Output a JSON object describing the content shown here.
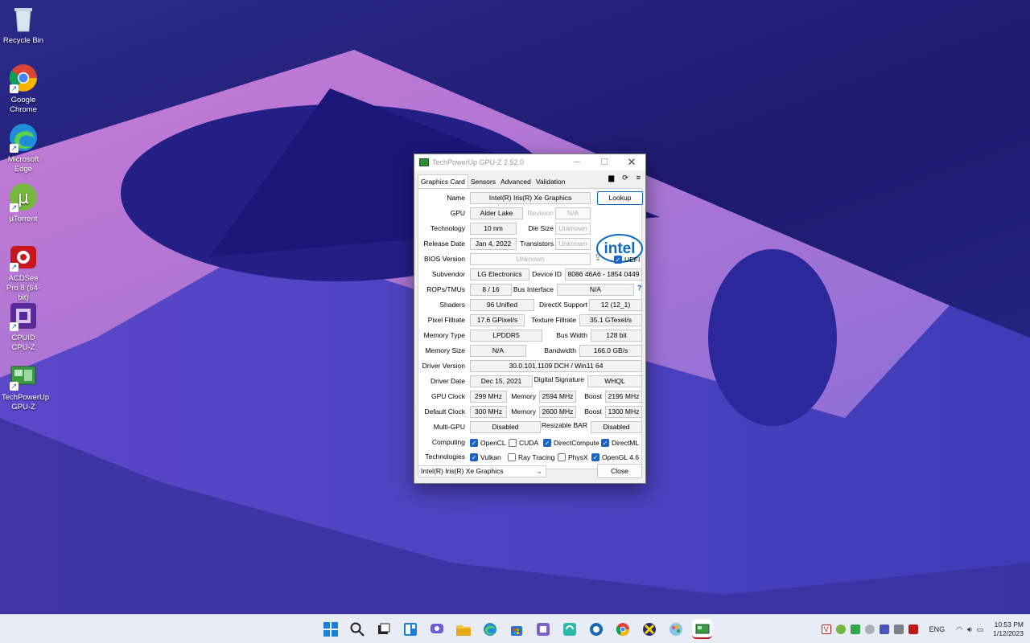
{
  "desktop": {
    "icons": [
      {
        "label": "Recycle Bin"
      },
      {
        "label": "Google Chrome"
      },
      {
        "label": "Microsoft Edge"
      },
      {
        "label": "µTorrent"
      },
      {
        "label": "ACDSee Pro 8 (64-bit)"
      },
      {
        "label": "CPUID CPU-Z"
      },
      {
        "label": "TechPowerUp GPU-Z"
      }
    ]
  },
  "window": {
    "title": "TechPowerUp GPU-Z 2.52.0",
    "tabs": [
      "Graphics Card",
      "Sensors",
      "Advanced",
      "Validation"
    ],
    "lookup_label": "Lookup",
    "logo_text": "intel",
    "fields": {
      "name_label": "Name",
      "name": "Intel(R) Iris(R) Xe Graphics",
      "gpu_label": "GPU",
      "gpu": "Alder Lake",
      "revision_label": "Revision",
      "revision": "N/A",
      "technology_label": "Technology",
      "technology": "10 nm",
      "die_size_label": "Die Size",
      "die_size": "Unknown",
      "release_date_label": "Release Date",
      "release_date": "Jan 4, 2022",
      "transistors_label": "Transistors",
      "transistors": "Unknown",
      "bios_label": "BIOS Version",
      "bios": "Unknown",
      "uefi_label": "UEFI",
      "subvendor_label": "Subvendor",
      "subvendor": "LG Electronics",
      "device_id_label": "Device ID",
      "device_id": "8086 46A6 - 1854 0449",
      "rops_label": "ROPs/TMUs",
      "rops": "8 / 16",
      "bus_interface_label": "Bus Interface",
      "bus_interface": "N/A",
      "help": "?",
      "shaders_label": "Shaders",
      "shaders": "96 Unified",
      "directx_label": "DirectX Support",
      "directx": "12 (12_1)",
      "pixel_label": "Pixel Fillrate",
      "pixel": "17.6 GPixel/s",
      "texture_label": "Texture Fillrate",
      "texture": "35.1 GTexel/s",
      "memtype_label": "Memory Type",
      "memtype": "LPDDR5",
      "buswidth_label": "Bus Width",
      "buswidth": "128 bit",
      "memsize_label": "Memory Size",
      "memsize": "N/A",
      "bandwidth_label": "Bandwidth",
      "bandwidth": "166.0 GB/s",
      "driver_version_label": "Driver Version",
      "driver_version": "30.0.101.1109 DCH / Win11 64",
      "driver_date_label": "Driver Date",
      "driver_date": "Dec 15, 2021",
      "digsig_label": "Digital Signature",
      "digsig": "WHQL",
      "gpuclock_label": "GPU Clock",
      "gpuclock": "299 MHz",
      "memory_label": "Memory",
      "gpu_memory": "2594 MHz",
      "boost_label": "Boost",
      "gpu_boost": "2195 MHz",
      "defclock_label": "Default Clock",
      "defclock": "300 MHz",
      "def_memory": "2600 MHz",
      "def_boost": "1300 MHz",
      "multigpu_label": "Multi-GPU",
      "multigpu": "Disabled",
      "rebar_label": "Resizable BAR",
      "rebar": "Disabled",
      "computing_label": "Computing",
      "technologies_label": "Technologies"
    },
    "computing": [
      {
        "label": "OpenCL",
        "checked": true
      },
      {
        "label": "CUDA",
        "checked": false
      },
      {
        "label": "DirectCompute",
        "checked": true
      },
      {
        "label": "DirectML",
        "checked": true
      }
    ],
    "technologies": [
      {
        "label": "Vulkan",
        "checked": true
      },
      {
        "label": "Ray Tracing",
        "checked": false
      },
      {
        "label": "PhysX",
        "checked": false
      },
      {
        "label": "OpenGL 4.6",
        "checked": true
      }
    ],
    "device_select": "Intel(R) Iris(R) Xe Graphics",
    "close_label": "Close"
  },
  "taskbar": {
    "language": "ENG",
    "time": "10:53 PM",
    "date": "1/12/2023"
  }
}
